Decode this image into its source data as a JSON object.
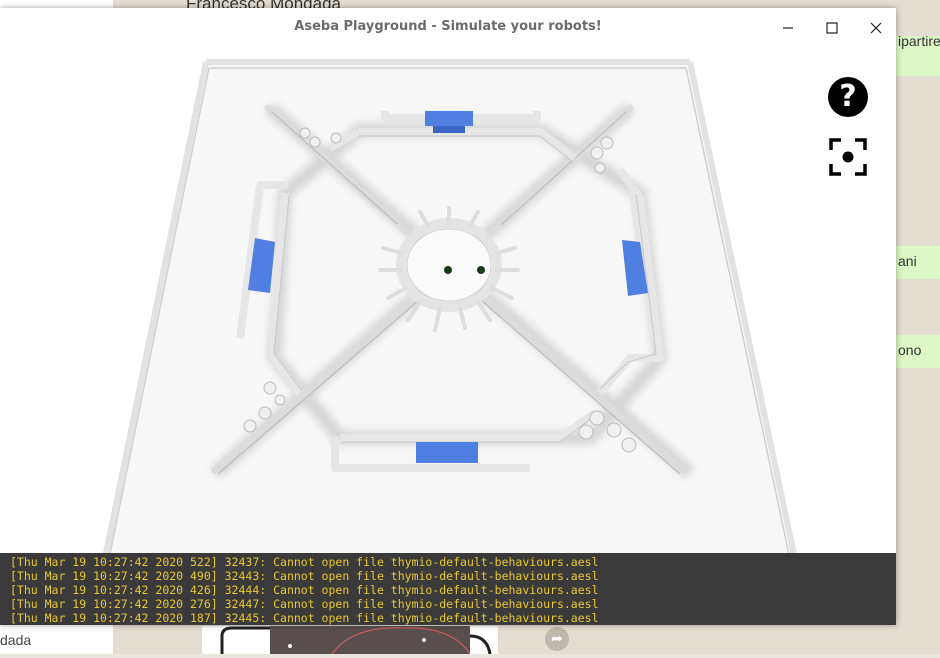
{
  "background": {
    "contact_name": "Francesco Mondada",
    "bubbles": [
      "ipartire",
      "ani",
      "ono"
    ],
    "bottom_left_text": "dada"
  },
  "window": {
    "title": "Aseba Playground - Simulate your robots!",
    "minimize_icon": "minimize-icon",
    "maximize_icon": "maximize-icon",
    "close_icon": "close-icon"
  },
  "overlay": {
    "help_label": "?",
    "help_icon": "question-icon",
    "fullscreen_icon": "fullscreen-icon"
  },
  "console": {
    "lines": [
      "[Thu Mar 19 10:27:42 2020 522] 32437: Cannot open file thymio-default-behaviours.aesl",
      "[Thu Mar 19 10:27:42 2020 490] 32443: Cannot open file thymio-default-behaviours.aesl",
      "[Thu Mar 19 10:27:42 2020 426] 32444: Cannot open file thymio-default-behaviours.aesl",
      "[Thu Mar 19 10:27:42 2020 276] 32447: Cannot open file thymio-default-behaviours.aesl",
      "[Thu Mar 19 10:27:42 2020 187] 32445: Cannot open file thymio-default-behaviours.aesl"
    ],
    "text_color": "#e8c832"
  },
  "colors": {
    "goal_blue": "#4f7fe0",
    "console_bg": "#3a3a3a"
  }
}
